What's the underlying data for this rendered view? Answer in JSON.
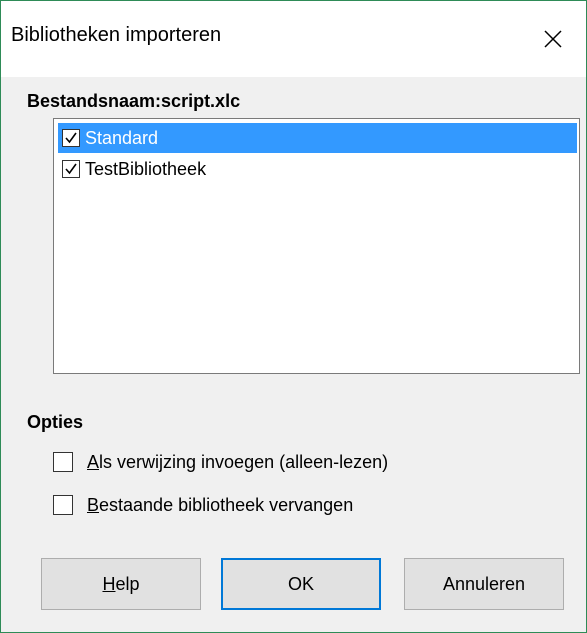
{
  "dialog": {
    "title": "Bibliotheken importeren",
    "close_icon": "close-icon"
  },
  "file_label": "Bestandsnaam:script.xlc",
  "libraries": [
    {
      "label": "Standard",
      "checked": true,
      "selected": true
    },
    {
      "label": "TestBibliotheek",
      "checked": true,
      "selected": false
    }
  ],
  "options": {
    "heading": "Opties",
    "insert_reference": {
      "accel": "A",
      "rest": "ls verwijzing invoegen (alleen-lezen)",
      "checked": false
    },
    "replace_existing": {
      "accel": "B",
      "rest": "estaande bibliotheek vervangen",
      "checked": false
    }
  },
  "buttons": {
    "help": {
      "accel": "H",
      "rest": "elp"
    },
    "ok": "OK",
    "cancel": "Annuleren"
  },
  "colors": {
    "selection": "#3399ff",
    "default_button_border": "#0078d7",
    "window_border": "#2e8b57"
  }
}
